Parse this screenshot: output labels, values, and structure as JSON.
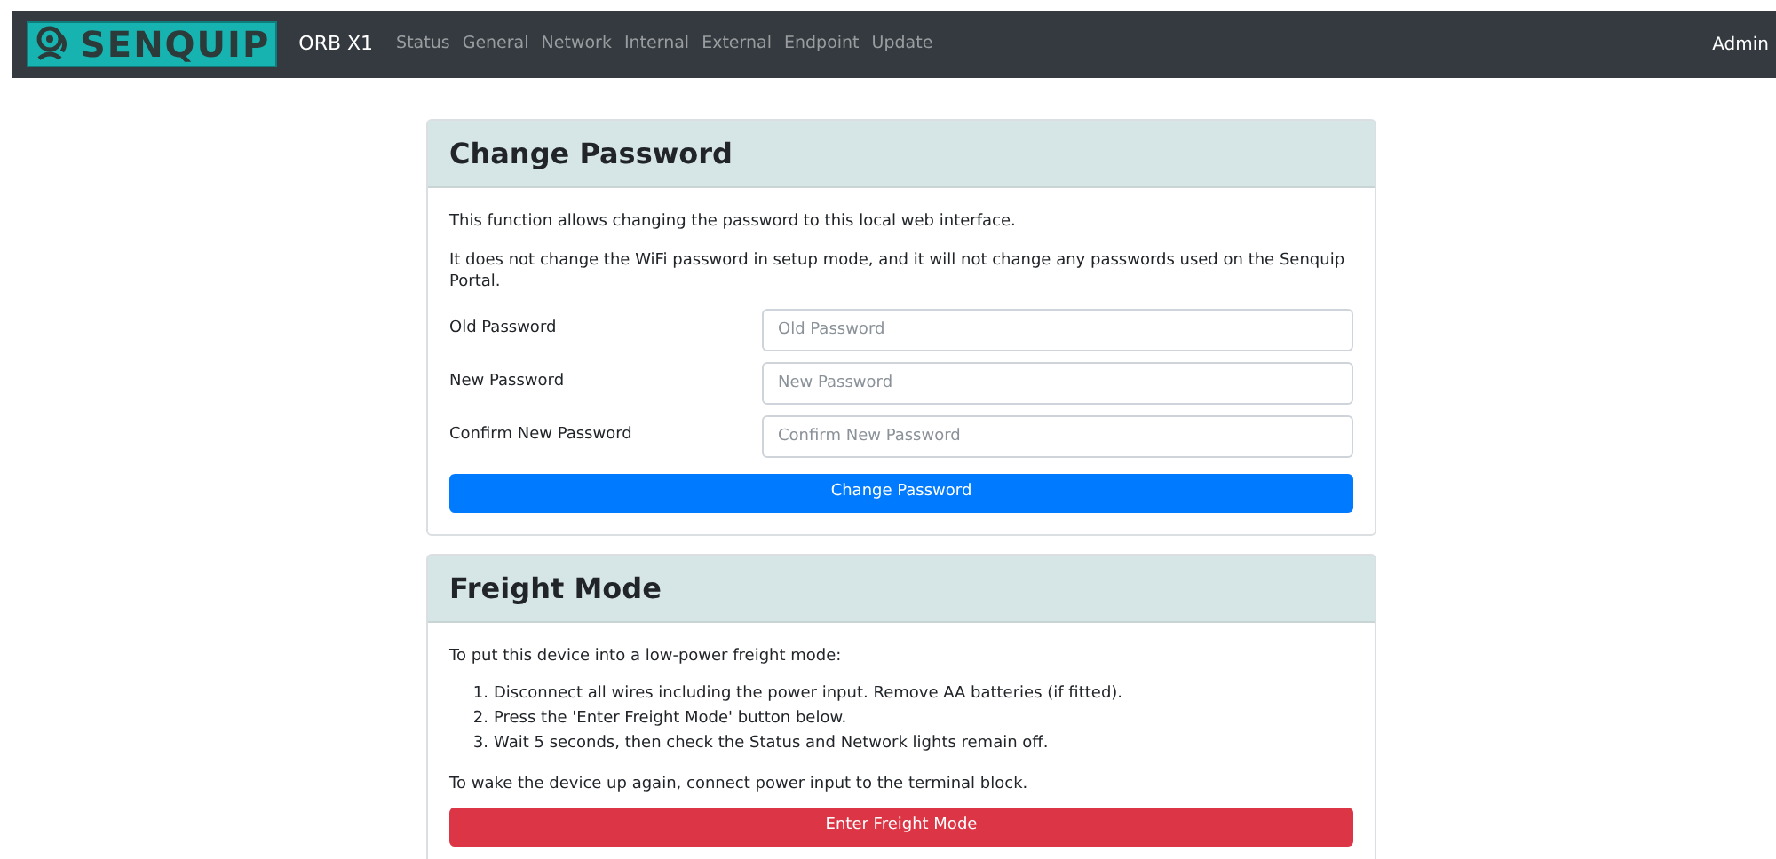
{
  "navbar": {
    "logo_text": "SENQUIP",
    "device": "ORB X1",
    "links": [
      {
        "label": "Status"
      },
      {
        "label": "General"
      },
      {
        "label": "Network"
      },
      {
        "label": "Internal"
      },
      {
        "label": "External"
      },
      {
        "label": "Endpoint"
      },
      {
        "label": "Update"
      }
    ],
    "user": "Admin"
  },
  "cards": [
    {
      "title": "Change Password",
      "paragraphs": [
        "This function allows changing the password to this local web interface.",
        "It does not change the WiFi password in setup mode, and it will not change any passwords used on the Senquip Portal."
      ],
      "fields": [
        {
          "label": "Old Password",
          "placeholder": "Old Password"
        },
        {
          "label": "New Password",
          "placeholder": "New Password"
        },
        {
          "label": "Confirm New Password",
          "placeholder": "Confirm New Password"
        }
      ],
      "button": {
        "label": "Change Password",
        "kind": "primary"
      }
    },
    {
      "title": "Freight Mode",
      "paragraphs": [
        "To put this device into a low-power freight mode:"
      ],
      "steps": [
        {
          "number": "1.",
          "text": "Disconnect all wires including the power input. Remove AA batteries (if fitted)."
        },
        {
          "number": "2.",
          "text": "Press the 'Enter Freight Mode' button below."
        },
        {
          "number": "3.",
          "text": "Wait 5 seconds, then check the Status and Network lights remain off."
        }
      ],
      "after": "To wake the device up again, connect power input to the terminal block.",
      "button": {
        "label": "Enter Freight Mode",
        "kind": "danger"
      }
    }
  ]
}
